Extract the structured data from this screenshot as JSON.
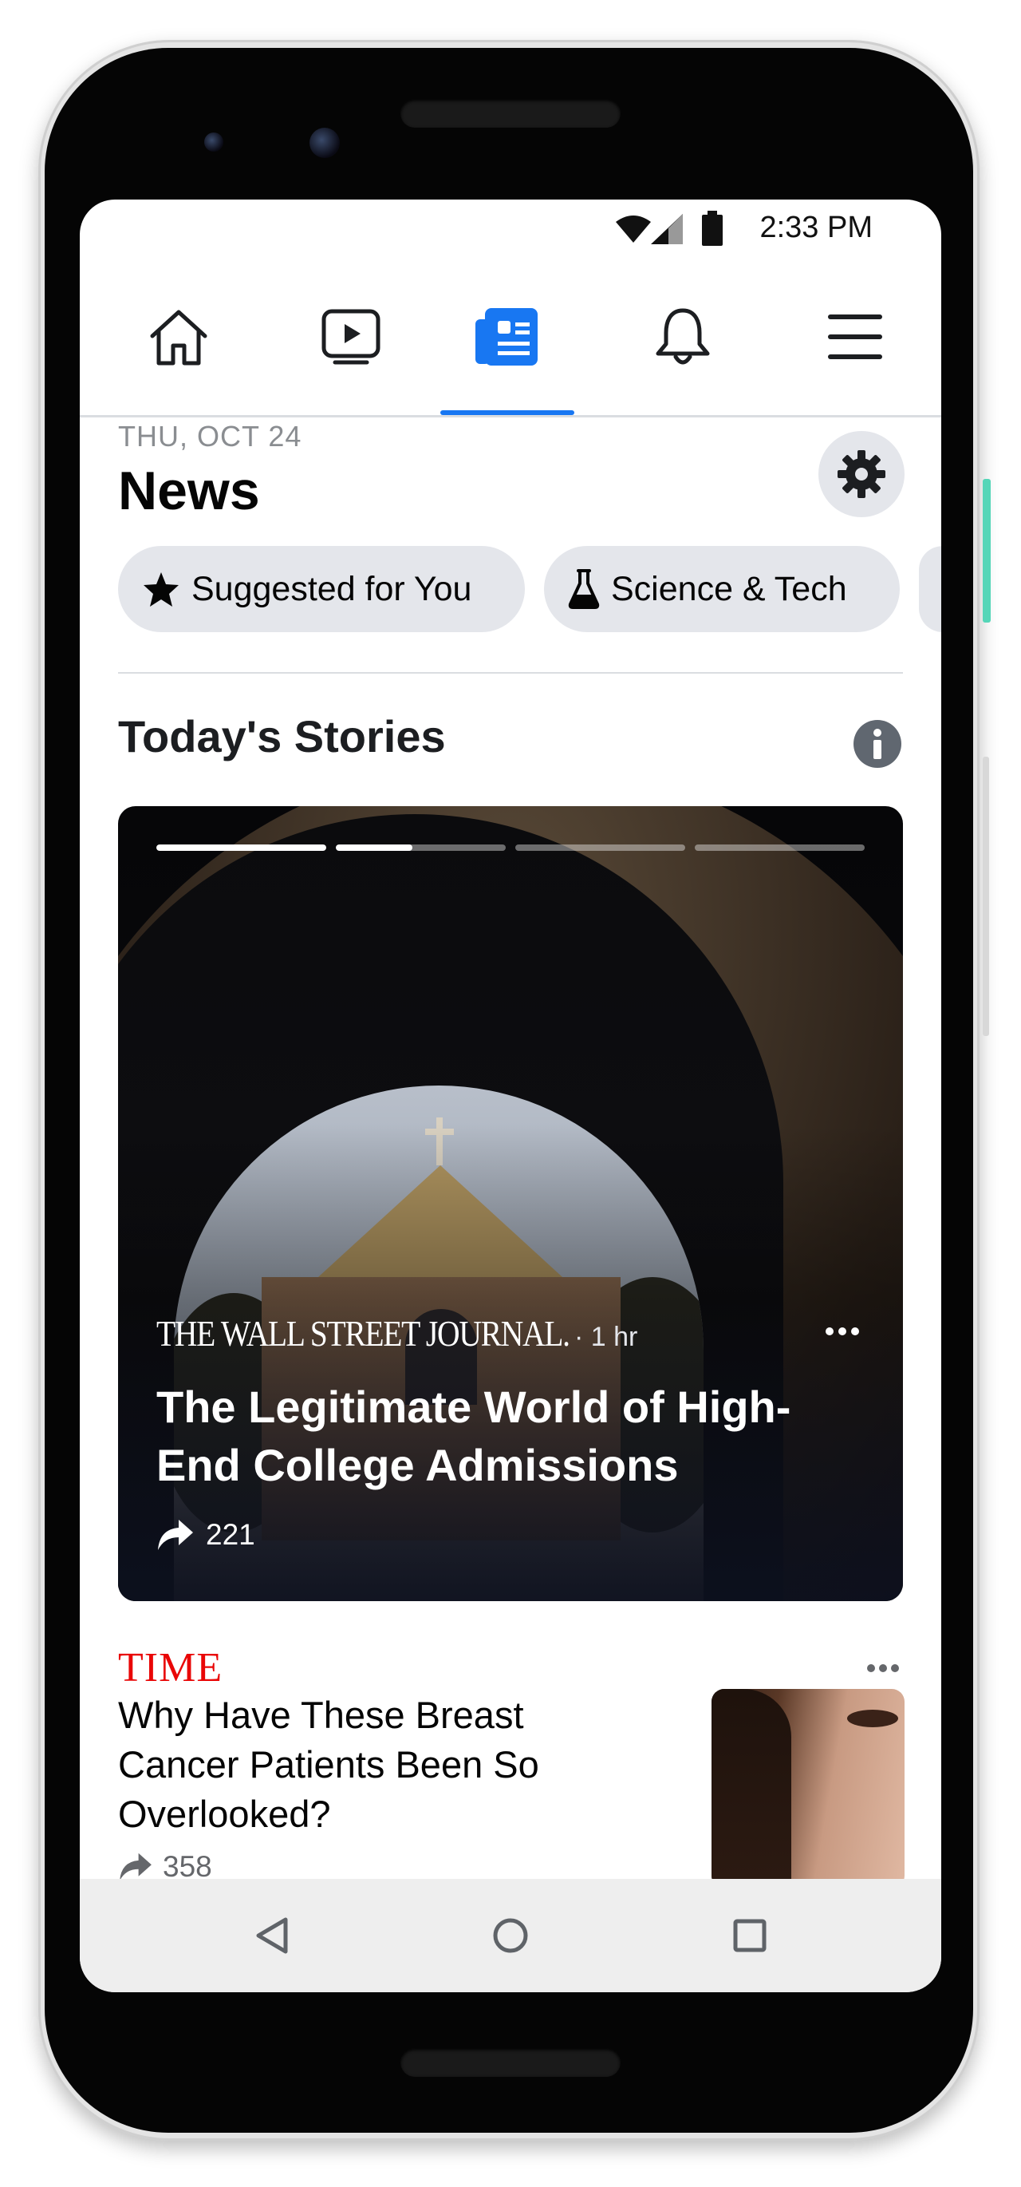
{
  "status_bar": {
    "time": "2:33 PM",
    "icons": [
      "wifi-icon",
      "signal-icon",
      "battery-icon"
    ]
  },
  "top_nav": {
    "tabs": [
      {
        "icon": "home-icon",
        "active": false
      },
      {
        "icon": "watch-icon",
        "active": false
      },
      {
        "icon": "news-icon",
        "active": true
      },
      {
        "icon": "notifications-bell-icon",
        "active": false
      },
      {
        "icon": "menu-icon",
        "active": false
      }
    ],
    "accent_color": "#1877f2"
  },
  "header": {
    "date": "THU, OCT 24",
    "title": "News",
    "settings_icon": "gear-icon"
  },
  "chips": [
    {
      "label": "Suggested for You",
      "icon": "star-icon"
    },
    {
      "label": "Science & Tech",
      "icon": "flask-icon"
    }
  ],
  "todays_stories": {
    "title": "Today's Stories",
    "info_icon": "info-icon",
    "story_progress": [
      1.0,
      0.45,
      0.0,
      0.0
    ],
    "card": {
      "publisher": "THE WALL STREET JOURNAL.",
      "time": " · 1 hr",
      "headline": "The Legitimate World of High-End College Admissions",
      "shares": "221"
    }
  },
  "story_2": {
    "publisher": "TIME",
    "publisher_color": "#e90606",
    "headline": "Why Have These Breast Cancer Patients Been So Overlooked?",
    "shares": "358"
  },
  "system_nav": {
    "buttons": [
      "back-icon",
      "home-circle-icon",
      "recents-icon"
    ]
  }
}
